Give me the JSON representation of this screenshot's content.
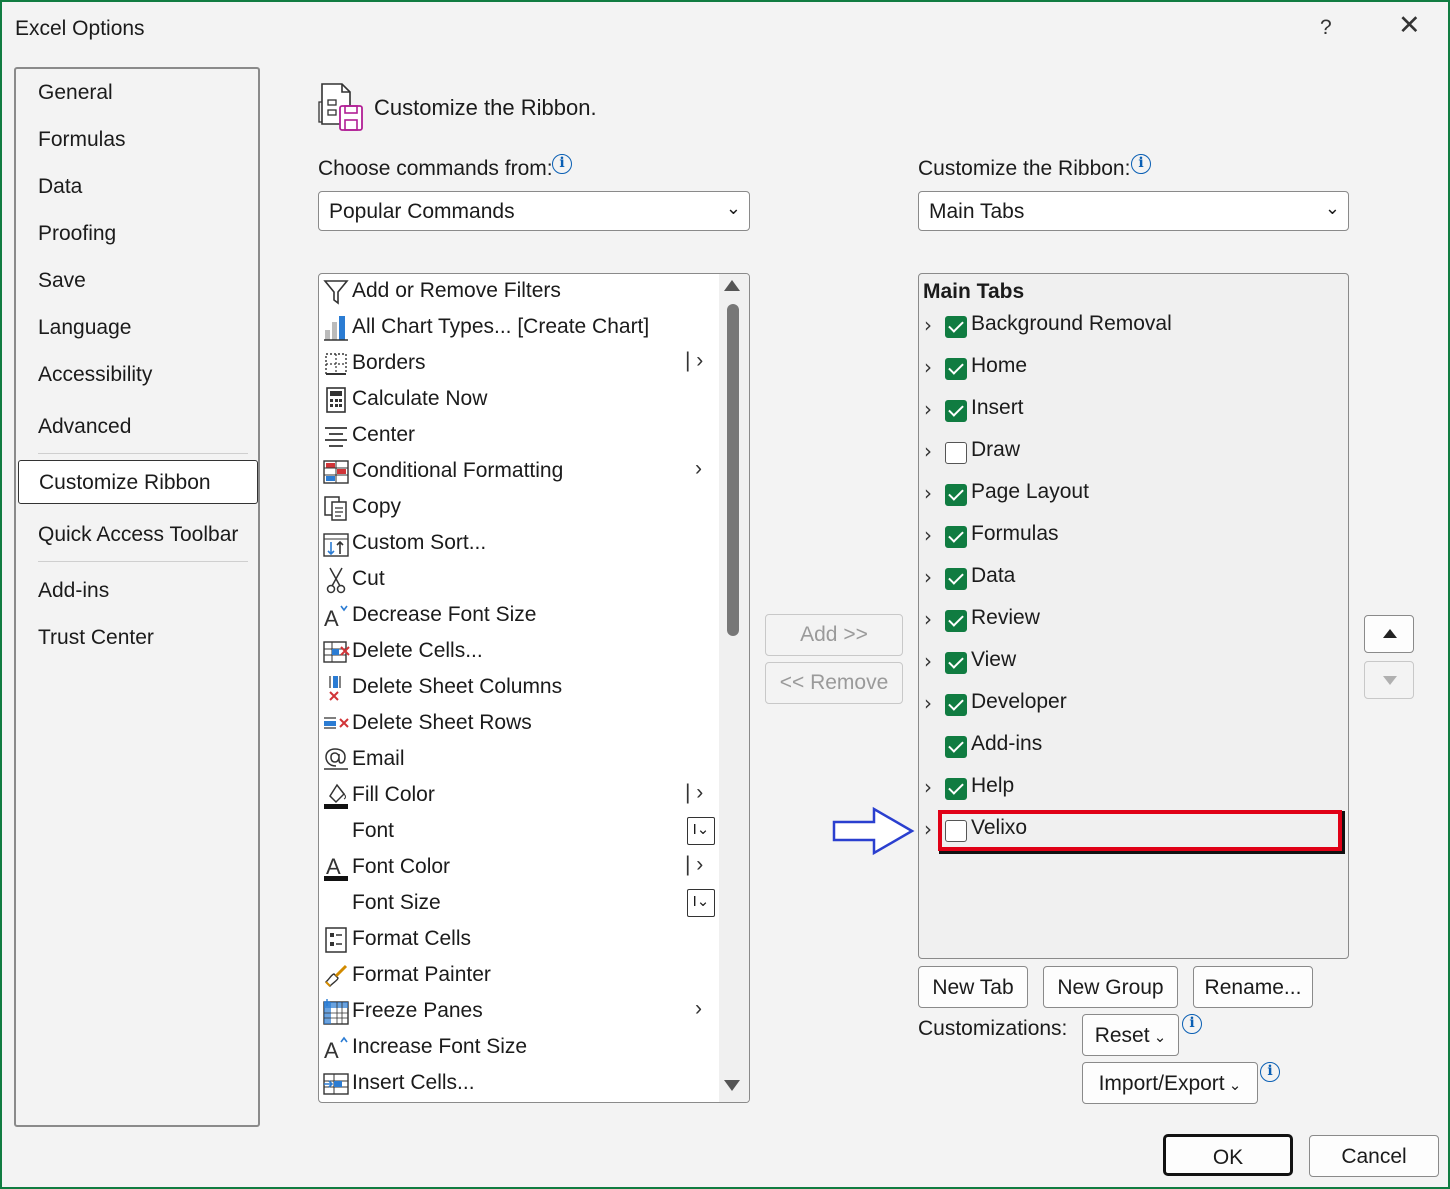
{
  "window": {
    "title": "Excel Options",
    "help": "?",
    "close": "✕"
  },
  "nav": {
    "items": [
      {
        "label": "General"
      },
      {
        "label": "Formulas"
      },
      {
        "label": "Data"
      },
      {
        "label": "Proofing"
      },
      {
        "label": "Save"
      },
      {
        "label": "Language"
      },
      {
        "label": "Accessibility"
      },
      {
        "label": "Advanced"
      },
      {
        "label": "Customize Ribbon",
        "selected": true
      },
      {
        "label": "Quick Access Toolbar"
      },
      {
        "label": "Add-ins"
      },
      {
        "label": "Trust Center"
      }
    ]
  },
  "header": {
    "title": "Customize the Ribbon."
  },
  "left": {
    "label": "Choose commands from:",
    "dropdown_value": "Popular Commands",
    "commands": [
      {
        "label": "Add or Remove Filters",
        "icon": "filter-icon"
      },
      {
        "label": "All Chart Types... [Create Chart]",
        "icon": "chart-icon"
      },
      {
        "label": "Borders",
        "icon": "borders-icon",
        "submenu": "split"
      },
      {
        "label": "Calculate Now",
        "icon": "calculator-icon"
      },
      {
        "label": "Center",
        "icon": "align-center-icon"
      },
      {
        "label": "Conditional Formatting",
        "icon": "conditional-formatting-icon",
        "submenu": "arrow"
      },
      {
        "label": "Copy",
        "icon": "copy-icon"
      },
      {
        "label": "Custom Sort...",
        "icon": "sort-icon"
      },
      {
        "label": "Cut",
        "icon": "scissors-icon"
      },
      {
        "label": "Decrease Font Size",
        "icon": "decrease-font-icon"
      },
      {
        "label": "Delete Cells...",
        "icon": "delete-cells-icon"
      },
      {
        "label": "Delete Sheet Columns",
        "icon": "delete-columns-icon"
      },
      {
        "label": "Delete Sheet Rows",
        "icon": "delete-rows-icon"
      },
      {
        "label": "Email",
        "icon": "email-icon"
      },
      {
        "label": "Fill Color",
        "icon": "fill-color-icon",
        "submenu": "split"
      },
      {
        "label": "Font",
        "icon": "",
        "submenu": "combo"
      },
      {
        "label": "Font Color",
        "icon": "font-color-icon",
        "submenu": "split"
      },
      {
        "label": "Font Size",
        "icon": "",
        "submenu": "combo"
      },
      {
        "label": "Format Cells",
        "icon": "format-cells-icon"
      },
      {
        "label": "Format Painter",
        "icon": "format-painter-icon"
      },
      {
        "label": "Freeze Panes",
        "icon": "freeze-panes-icon",
        "submenu": "arrow"
      },
      {
        "label": "Increase Font Size",
        "icon": "increase-font-icon"
      },
      {
        "label": "Insert Cells...",
        "icon": "insert-cells-icon"
      }
    ]
  },
  "middle": {
    "add": "Add >>",
    "remove": "<< Remove"
  },
  "right": {
    "label": "Customize the Ribbon:",
    "dropdown_value": "Main Tabs",
    "tree_header": "Main Tabs",
    "tabs": [
      {
        "label": "Background Removal",
        "checked": true,
        "expandable": true
      },
      {
        "label": "Home",
        "checked": true,
        "expandable": true
      },
      {
        "label": "Insert",
        "checked": true,
        "expandable": true
      },
      {
        "label": "Draw",
        "checked": false,
        "expandable": true
      },
      {
        "label": "Page Layout",
        "checked": true,
        "expandable": true
      },
      {
        "label": "Formulas",
        "checked": true,
        "expandable": true
      },
      {
        "label": "Data",
        "checked": true,
        "expandable": true
      },
      {
        "label": "Review",
        "checked": true,
        "expandable": true
      },
      {
        "label": "View",
        "checked": true,
        "expandable": true
      },
      {
        "label": "Developer",
        "checked": true,
        "expandable": true
      },
      {
        "label": "Add-ins",
        "checked": true,
        "expandable": false
      },
      {
        "label": "Help",
        "checked": true,
        "expandable": true
      },
      {
        "label": "Velixo",
        "checked": false,
        "expandable": true,
        "highlighted": true
      }
    ],
    "buttons": {
      "new_tab": "New Tab",
      "new_group": "New Group",
      "rename": "Rename..."
    },
    "customizations_label": "Customizations:",
    "reset": "Reset",
    "import_export": "Import/Export"
  },
  "footer": {
    "ok": "OK",
    "cancel": "Cancel"
  },
  "colors": {
    "accent": "#107c41",
    "highlight": "#e00016",
    "arrow": "#2a3fcf"
  }
}
